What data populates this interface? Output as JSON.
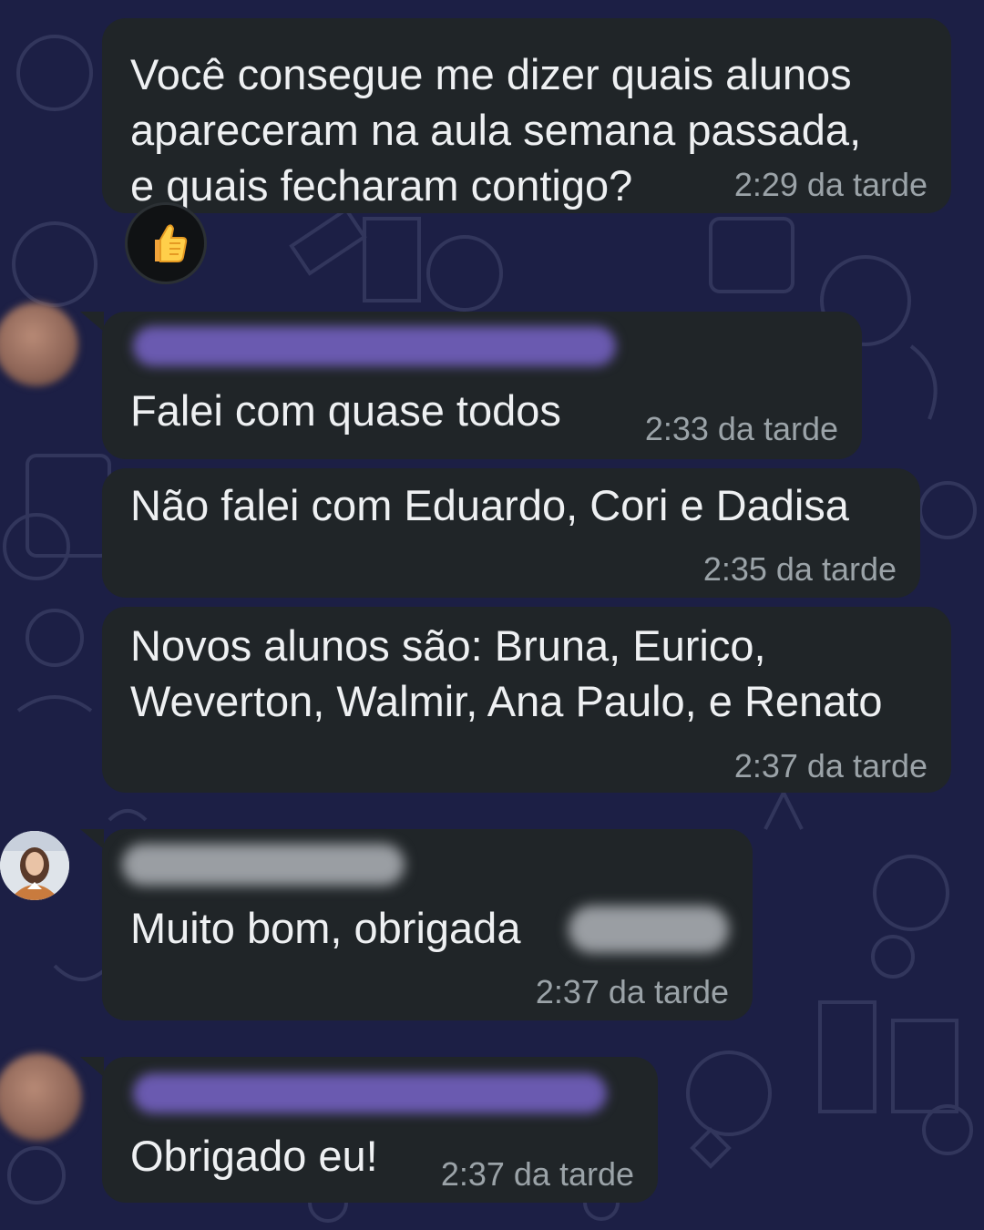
{
  "messages": [
    {
      "id": "m1",
      "direction": "outgoing",
      "text": "Você consegue me dizer quais alunos\napareceram na aula semana passada,\ne quais fecharam contigo?",
      "time": "2:29 da tarde",
      "reaction": "thumbs-up"
    },
    {
      "id": "m2",
      "direction": "incoming",
      "sender_name_redacted": true,
      "text": "Falei com quase todos",
      "time": "2:33 da tarde"
    },
    {
      "id": "m3",
      "direction": "incoming",
      "text": "Não falei com Eduardo, Cori e Dadisa",
      "time": "2:35 da tarde"
    },
    {
      "id": "m4",
      "direction": "incoming",
      "text": "Novos alunos são: Bruna, Eurico,\nWeverton, Walmir, Ana Paulo, e Renato",
      "time": "2:37 da tarde"
    },
    {
      "id": "m5",
      "direction": "incoming",
      "sender_name_redacted": true,
      "text": "Muito bom, obrigada",
      "time": "2:37 da tarde"
    },
    {
      "id": "m6",
      "direction": "incoming",
      "sender_name_redacted": true,
      "text": "Obrigado eu!",
      "time": "2:37 da tarde"
    }
  ],
  "colors": {
    "background": "#1c1f45",
    "bubble": "#202528",
    "text": "#eef0f2",
    "timestamp": "#9ba3a8",
    "redacted_name": "#6a5ab0"
  },
  "icons": {
    "reaction": "thumbs-up-icon",
    "wallpaper": "doodle-pattern"
  }
}
